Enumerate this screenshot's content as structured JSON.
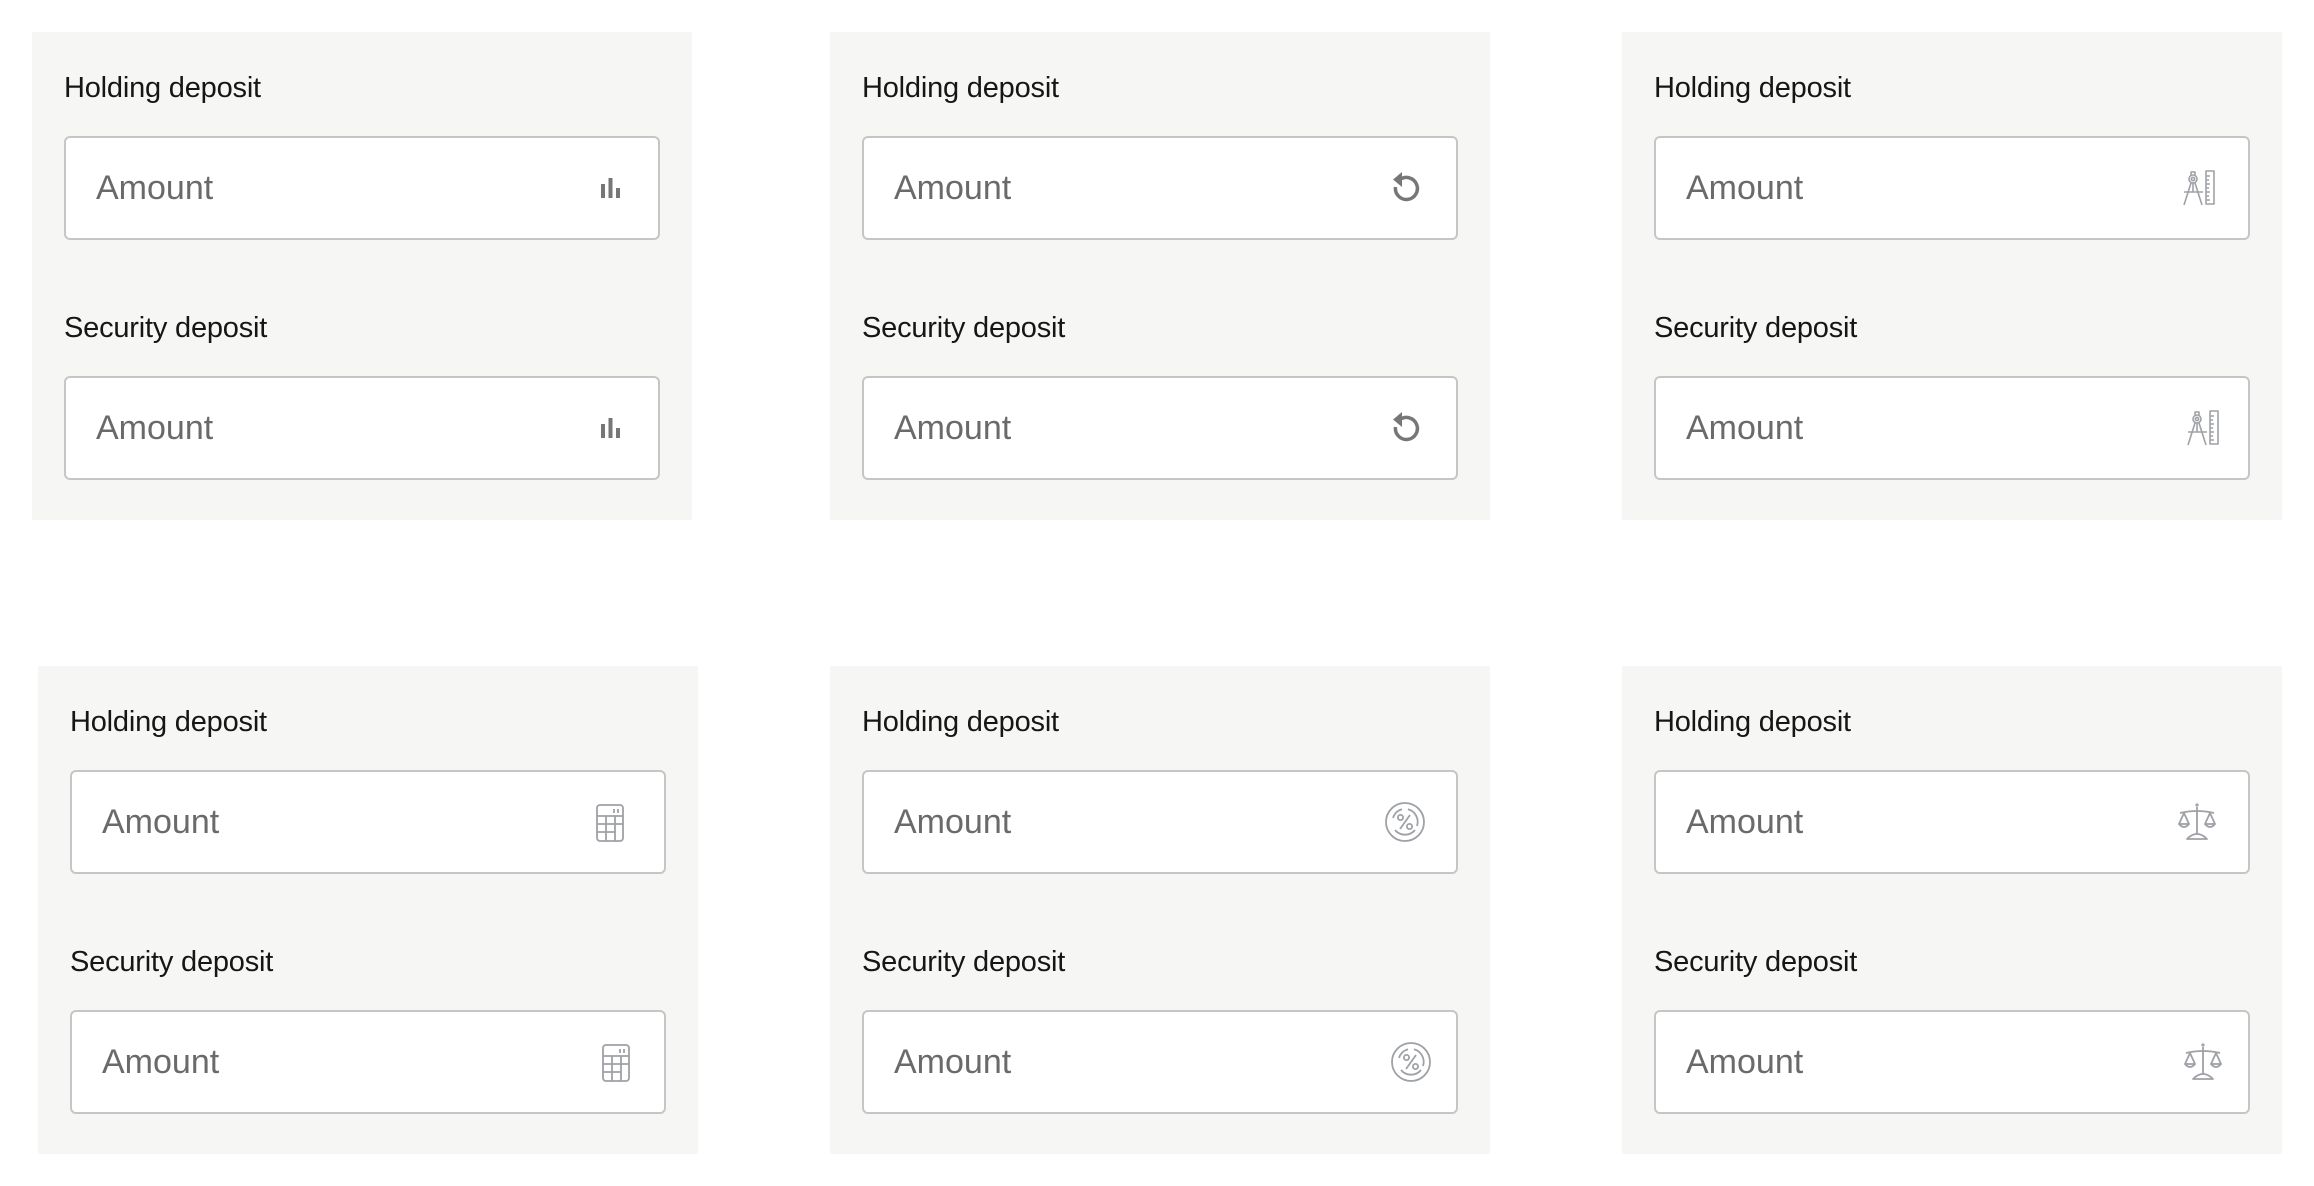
{
  "panels": [
    {
      "variant": "bar-chart",
      "fields": [
        {
          "label": "Holding deposit",
          "placeholder": "Amount",
          "value": "",
          "icon": "bar-chart-icon"
        },
        {
          "label": "Security deposit",
          "placeholder": "Amount",
          "value": "",
          "icon": "bar-chart-icon"
        }
      ]
    },
    {
      "variant": "undo",
      "fields": [
        {
          "label": "Holding deposit",
          "placeholder": "Amount",
          "value": "",
          "icon": "undo-icon"
        },
        {
          "label": "Security deposit",
          "placeholder": "Amount",
          "value": "",
          "icon": "undo-icon"
        }
      ]
    },
    {
      "variant": "compass-ruler",
      "fields": [
        {
          "label": "Holding deposit",
          "placeholder": "Amount",
          "value": "",
          "icon": "compass-ruler-icon"
        },
        {
          "label": "Security deposit",
          "placeholder": "Amount",
          "value": "",
          "icon": "compass-ruler-icon"
        }
      ]
    },
    {
      "variant": "calculator",
      "fields": [
        {
          "label": "Holding deposit",
          "placeholder": "Amount",
          "value": "",
          "icon": "calculator-icon"
        },
        {
          "label": "Security deposit",
          "placeholder": "Amount",
          "value": "",
          "icon": "calculator-icon"
        }
      ]
    },
    {
      "variant": "percent",
      "fields": [
        {
          "label": "Holding deposit",
          "placeholder": "Amount",
          "value": "",
          "icon": "percent-icon"
        },
        {
          "label": "Security deposit",
          "placeholder": "Amount",
          "value": "",
          "icon": "percent-icon"
        }
      ]
    },
    {
      "variant": "scales",
      "fields": [
        {
          "label": "Holding deposit",
          "placeholder": "Amount",
          "value": "",
          "icon": "scales-icon"
        },
        {
          "label": "Security deposit",
          "placeholder": "Amount",
          "value": "",
          "icon": "scales-icon"
        }
      ]
    }
  ],
  "colors": {
    "panel_bg": "#f6f6f5",
    "field_border": "#c6c6c6",
    "label_text": "#161616",
    "placeholder_text": "#6a6a6a",
    "icon_dark": "#777777",
    "icon_light": "#9ea1a6"
  }
}
